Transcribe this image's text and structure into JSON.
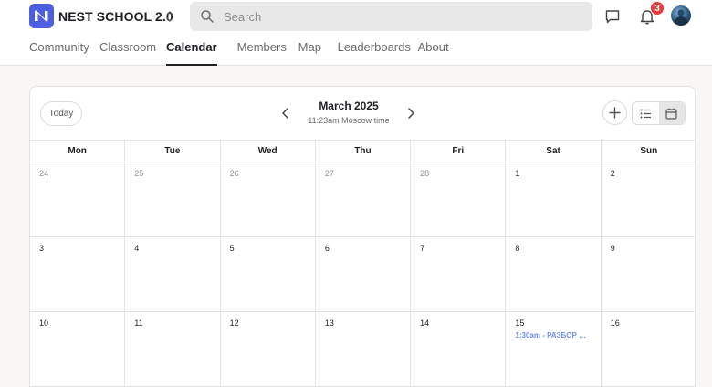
{
  "header": {
    "brand": "NEST SCHOOL 2.0",
    "notifications_count": "3",
    "search": {
      "placeholder": "Search"
    },
    "icons": [
      "app-logo-icon",
      "switch-chevrons-icon",
      "search-icon",
      "chat-icon",
      "bell-icon",
      "avatar"
    ]
  },
  "nav": {
    "tabs": [
      {
        "label": "Community"
      },
      {
        "label": "Classroom"
      },
      {
        "label": "Calendar",
        "active": true
      },
      {
        "label": "Members"
      },
      {
        "label": "Map"
      },
      {
        "label": "Leaderboards"
      },
      {
        "label": "About"
      }
    ]
  },
  "calendar": {
    "today_label": "Today",
    "month_title": "March 2025",
    "timezone_text": "11:23am Moscow time",
    "weekdays": [
      "Mon",
      "Tue",
      "Wed",
      "Thu",
      "Fri",
      "Sat",
      "Sun"
    ],
    "weeks": [
      [
        "24",
        "25",
        "26",
        "27",
        "28",
        "1",
        "2"
      ],
      [
        "3",
        "4",
        "5",
        "6",
        "7",
        "8",
        "9"
      ],
      [
        "10",
        "11",
        "12",
        "13",
        "14",
        "15",
        "16"
      ]
    ],
    "event": {
      "text": "1:30am - РАЗБОР …"
    },
    "colors": {
      "accent": "#4b5fe0",
      "event": "#6f8ef0",
      "badge": "#e63b3b"
    }
  }
}
